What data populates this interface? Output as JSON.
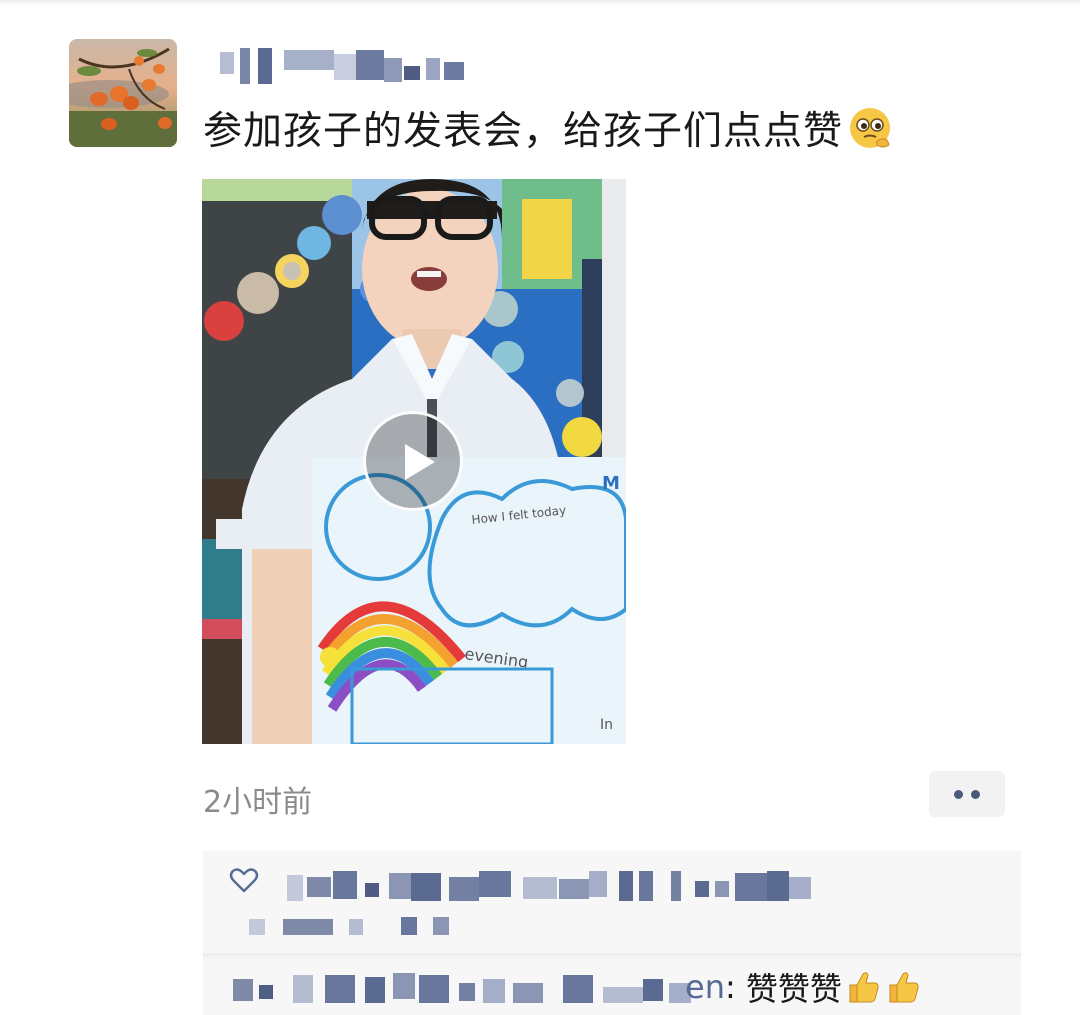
{
  "post": {
    "caption": "参加孩子的发表会，给孩子们点点赞",
    "caption_emoji": "pleading-face-emoji",
    "timestamp": "2小时前",
    "username_blurred": true
  },
  "video": {
    "has_play_button": true,
    "poster_texts": [
      "How I felt today",
      "evening",
      "In",
      "M"
    ]
  },
  "interactions": {
    "likes_blurred": true,
    "comment": {
      "name_suffix": "en",
      "separator": ": ",
      "text": "赞赞赞",
      "emojis": [
        "thumbs-up-emoji",
        "thumbs-up-emoji"
      ]
    }
  },
  "colors": {
    "link_blue": "#576b95",
    "time_gray": "#8a8a8a",
    "panel_bg": "#f7f7f7"
  }
}
